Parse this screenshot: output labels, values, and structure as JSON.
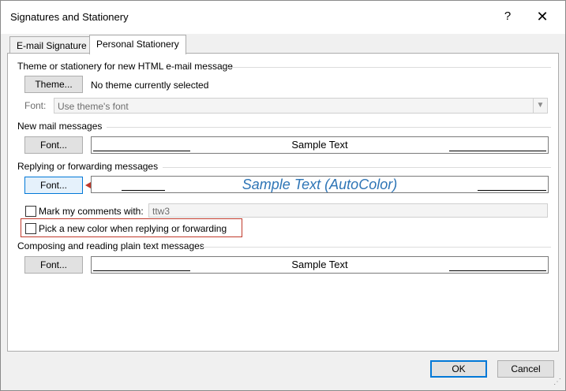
{
  "dialog": {
    "title": "Signatures and Stationery",
    "help_glyph": "?",
    "close_glyph": "✕"
  },
  "tabs": [
    {
      "label": "E-mail Signature",
      "active": false
    },
    {
      "label": "Personal Stationery",
      "active": true
    }
  ],
  "theme_section": {
    "heading": "Theme or stationery for new HTML e-mail message",
    "theme_button": "Theme...",
    "theme_status": "No theme currently selected",
    "font_label": "Font:",
    "font_value": "Use theme's font"
  },
  "new_mail": {
    "heading": "New mail messages",
    "font_button": "Font...",
    "sample": "Sample Text"
  },
  "reply": {
    "heading": "Replying or forwarding messages",
    "font_button": "Font...",
    "sample": "Sample Text (AutoColor)",
    "sample_color": "#2e75b6",
    "mark_label": "Mark my comments with:",
    "mark_value": "ttw3",
    "pick_color_label": "Pick a new color when replying or forwarding"
  },
  "plain_text": {
    "heading": "Composing and reading plain text messages",
    "font_button": "Font...",
    "sample": "Sample Text"
  },
  "footer": {
    "ok": "OK",
    "cancel": "Cancel"
  },
  "annotation": {
    "arrow_color": "#c0392b",
    "highlight_color": "#c0392b"
  }
}
